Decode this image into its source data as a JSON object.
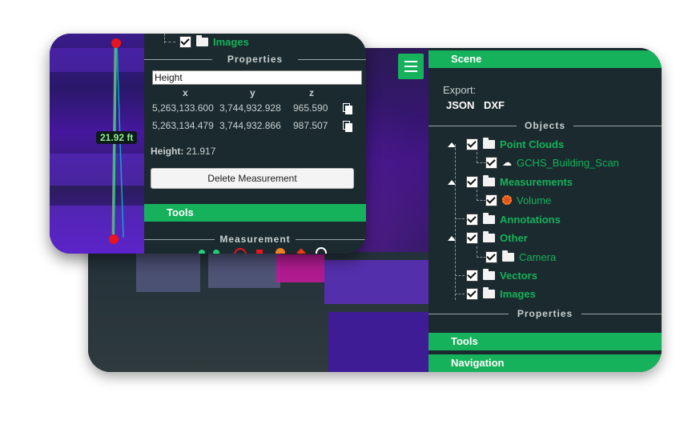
{
  "back": {
    "scene_label": "Scene",
    "export_label": "Export:",
    "export_json": "JSON",
    "export_dxf": "DXF",
    "objects_title": "Objects",
    "tree": {
      "point_clouds": "Point Clouds",
      "gchs": "GCHS_Building_Scan",
      "measurements": "Measurements",
      "volume": "Volume",
      "annotations": "Annotations",
      "other": "Other",
      "camera": "Camera",
      "vectors": "Vectors",
      "images": "Images"
    },
    "properties_title": "Properties",
    "tools_label": "Tools",
    "navigation_label": "Navigation",
    "icons": {
      "menu": "hamburger-icon",
      "folder": "folder-icon",
      "checkbox": "checkbox-icon",
      "cloud": "cloud-icon",
      "volume": "volume-icon"
    }
  },
  "front": {
    "images_label": "Images",
    "properties_title": "Properties",
    "name_value": "Height",
    "headers": {
      "x": "x",
      "y": "y",
      "z": "z"
    },
    "rows": [
      {
        "x": "5,263,133.600",
        "y": "3,744,932.928",
        "z": "965.590"
      },
      {
        "x": "5,263,134.479",
        "y": "3,744,932.866",
        "z": "987.507"
      }
    ],
    "height_label": "Height:",
    "height_value": "21.917",
    "delete_label": "Delete Measurement",
    "tools_label": "Tools",
    "measurement_title": "Measurement",
    "dimension_label": "21.92 ft"
  },
  "colors": {
    "accent": "#16b25b",
    "panel": "#1b2a2e",
    "point_marker": "#e8141e"
  }
}
